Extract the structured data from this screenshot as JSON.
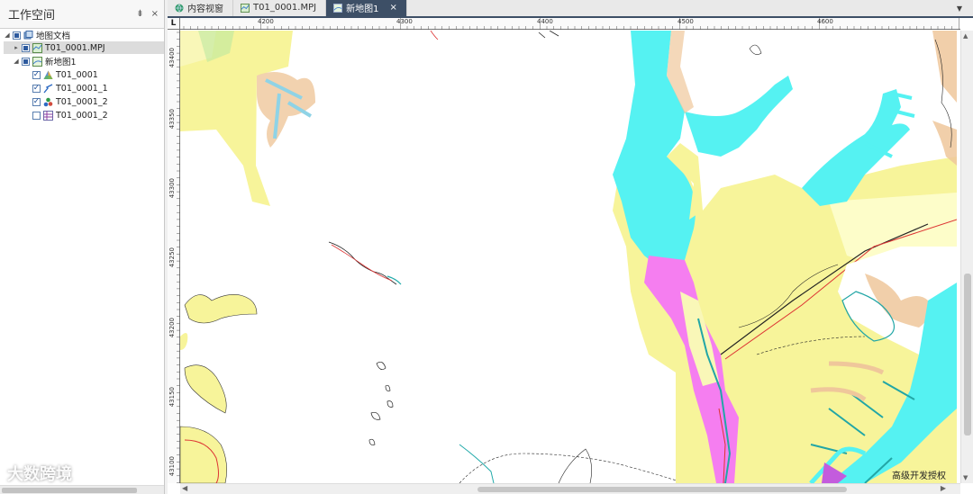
{
  "workspace": {
    "title": "工作空间",
    "pin_label": "⇟",
    "close_label": "×",
    "tree": [
      {
        "label": "地图文档",
        "level": 0,
        "arrow": "◢",
        "check": "partial",
        "icon": "map-doc-icon"
      },
      {
        "label": "T01_0001.MPJ",
        "level": 1,
        "arrow": "▸",
        "check": "partial",
        "icon": "project-icon",
        "selected": true
      },
      {
        "label": "新地图1",
        "level": 1,
        "arrow": "◢",
        "check": "partial",
        "icon": "map-icon"
      },
      {
        "label": "T01_0001",
        "level": 2,
        "arrow": "",
        "check": "checked",
        "icon": "area-layer-icon"
      },
      {
        "label": "T01_0001_1",
        "level": 2,
        "arrow": "",
        "check": "checked",
        "icon": "line-layer-icon"
      },
      {
        "label": "T01_0001_2",
        "level": 2,
        "arrow": "",
        "check": "checked",
        "icon": "point-layer-icon"
      },
      {
        "label": "T01_0001_2",
        "level": 2,
        "arrow": "",
        "check": "unchecked",
        "icon": "table-layer-icon"
      }
    ]
  },
  "tabs": [
    {
      "label": "内容视窗",
      "icon": "globe-icon",
      "active": false
    },
    {
      "label": "T01_0001.MPJ",
      "icon": "project-icon",
      "active": false
    },
    {
      "label": "新地图1",
      "icon": "map-icon",
      "active": true,
      "close": "×"
    }
  ],
  "tab_menu": "▼",
  "ruler": {
    "corner": "L",
    "x_ticks": [
      "4200",
      "4300",
      "4400",
      "4500",
      "4600"
    ],
    "y_ticks": [
      "43400",
      "43350",
      "43300",
      "43250",
      "43200",
      "43150",
      "43100"
    ]
  },
  "watermark": "大数跨境",
  "license_text": "高级开发授权",
  "colors": {
    "yellow": "#f7f49a",
    "cyan": "#55f2f2",
    "pink": "#f57ef0",
    "orange": "#efc79b",
    "green": "#bce7a0",
    "pale": "#fdfdc9"
  }
}
